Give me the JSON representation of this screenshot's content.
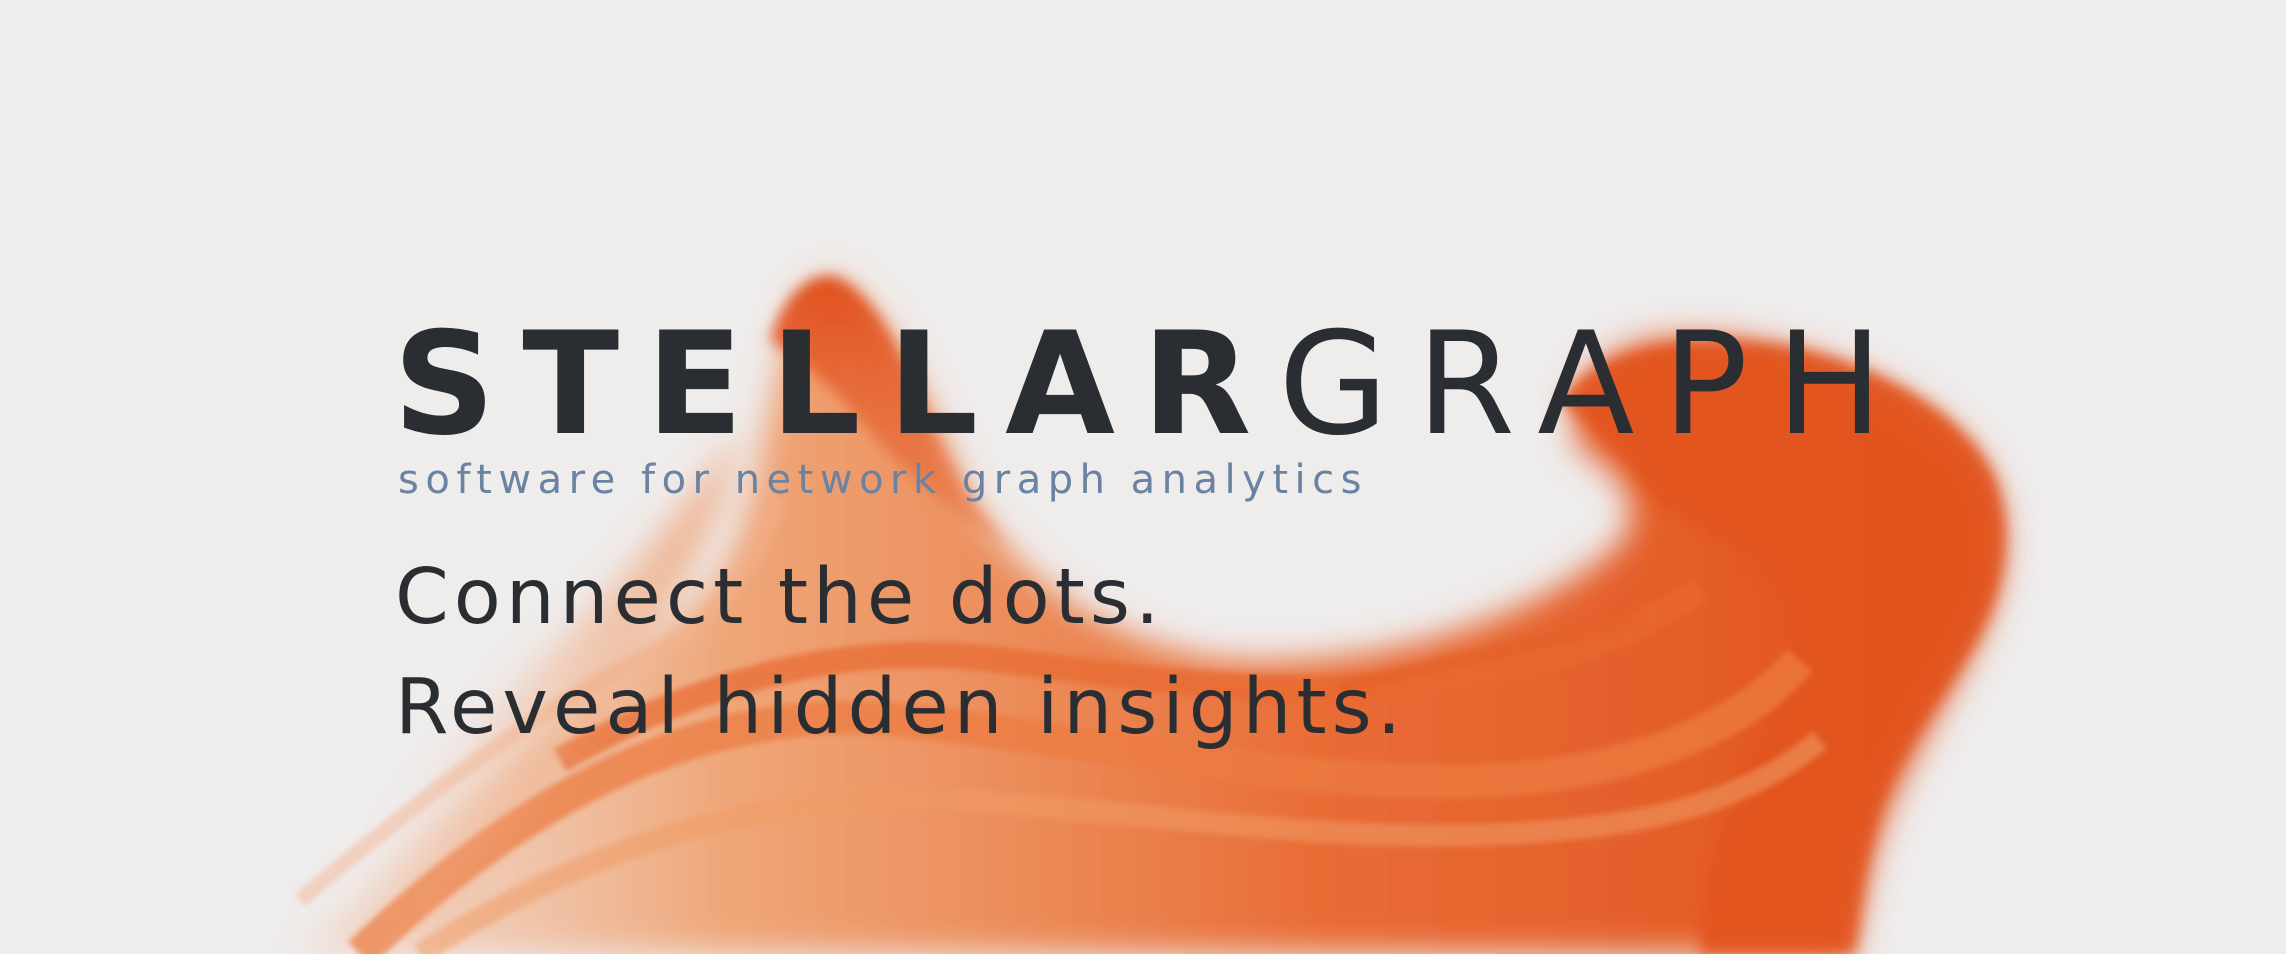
{
  "brand": {
    "name_bold": "STELLAR",
    "name_light": "GRAPH",
    "tagline": "software for network graph analytics"
  },
  "slogan": {
    "line1": "Connect the dots.",
    "line2": "Reveal hidden insights."
  },
  "colors": {
    "background": "#efecec",
    "text_dark": "#2a2e33",
    "tagline": "#6b83a3",
    "accent_orange": "#e2531f",
    "accent_orange_light": "#f0a070"
  },
  "decoration": {
    "background_art": "orange-smoke-wave"
  }
}
